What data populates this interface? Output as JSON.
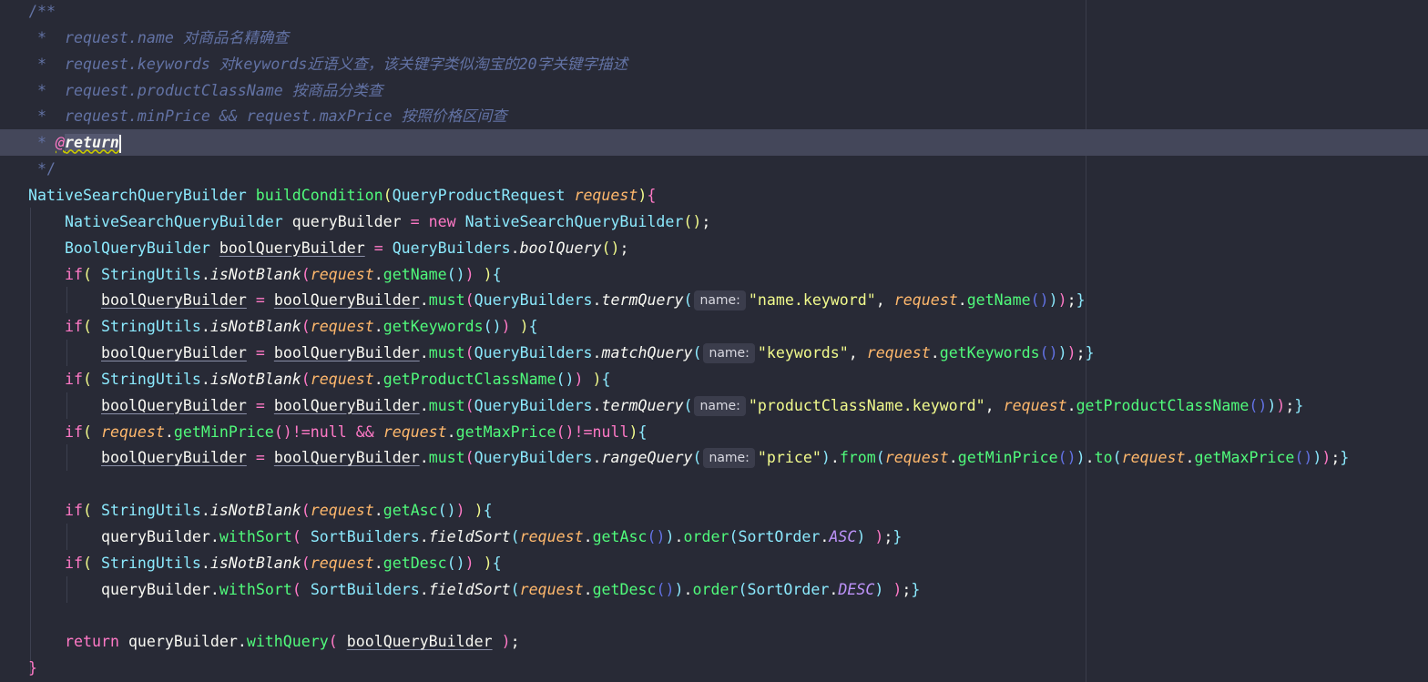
{
  "editor": {
    "lines": [
      {
        "indent": 0,
        "tokens": [
          [
            "/**",
            "cs"
          ]
        ]
      },
      {
        "indent": 0,
        "tokens": [
          [
            " *  ",
            "cs"
          ],
          [
            "request.name 对商品名精确查",
            "c"
          ]
        ]
      },
      {
        "indent": 0,
        "tokens": [
          [
            " *  ",
            "cs"
          ],
          [
            "request.keywords 对keywords近语义查，该关键字类似淘宝的20字关键字描述",
            "c"
          ]
        ]
      },
      {
        "indent": 0,
        "tokens": [
          [
            " *  ",
            "cs"
          ],
          [
            "request.productClassName 按商品分类查",
            "c"
          ]
        ]
      },
      {
        "indent": 0,
        "tokens": [
          [
            " *  ",
            "cs"
          ],
          [
            "request.minPrice && request.maxPrice 按照价格区间查",
            "c"
          ]
        ]
      },
      {
        "indent": 0,
        "current": true,
        "tokens": [
          [
            " * ",
            "cs"
          ],
          [
            "@",
            "tag"
          ],
          [
            "return",
            "tagw"
          ],
          [
            "",
            "caret"
          ]
        ]
      },
      {
        "indent": 0,
        "tokens": [
          [
            " */",
            "cs"
          ]
        ]
      },
      {
        "indent": 0,
        "tokens": [
          [
            "NativeSearchQueryBuilder ",
            "t"
          ],
          [
            "buildCondition",
            "f"
          ],
          [
            "(",
            "b1"
          ],
          [
            "QueryProductRequest ",
            "t"
          ],
          [
            "request",
            "p"
          ],
          [
            ")",
            "b1"
          ],
          [
            "{",
            "b2"
          ]
        ]
      },
      {
        "indent": 1,
        "tokens": [
          [
            "NativeSearchQueryBuilder ",
            "t"
          ],
          [
            "queryBuilder ",
            "v"
          ],
          [
            "= ",
            "k"
          ],
          [
            "new ",
            "k"
          ],
          [
            "NativeSearchQueryBuilder",
            "t"
          ],
          [
            "()",
            "b1"
          ],
          [
            ";",
            "v"
          ]
        ]
      },
      {
        "indent": 1,
        "tokens": [
          [
            "BoolQueryBuilder ",
            "t"
          ],
          [
            "boolQueryBuilder",
            "u"
          ],
          [
            " = ",
            "k"
          ],
          [
            "QueryBuilders",
            "t"
          ],
          [
            ".",
            "v"
          ],
          [
            "boolQuery",
            "m"
          ],
          [
            "()",
            "b1"
          ],
          [
            ";",
            "v"
          ]
        ]
      },
      {
        "indent": 1,
        "tokens": [
          [
            "if",
            "k"
          ],
          [
            "( ",
            "b1"
          ],
          [
            "StringUtils",
            "t"
          ],
          [
            ".",
            "v"
          ],
          [
            "isNotBlank",
            "m"
          ],
          [
            "(",
            "b2"
          ],
          [
            "request",
            "p"
          ],
          [
            ".",
            "v"
          ],
          [
            "getName",
            "f"
          ],
          [
            "()",
            "b3"
          ],
          [
            ")",
            "b2"
          ],
          [
            " )",
            "b1"
          ],
          [
            "{",
            "b3"
          ]
        ]
      },
      {
        "indent": 2,
        "tokens": [
          [
            "boolQueryBuilder",
            "u"
          ],
          [
            " = ",
            "k"
          ],
          [
            "boolQueryBuilder",
            "u"
          ],
          [
            ".",
            "v"
          ],
          [
            "must",
            "f"
          ],
          [
            "(",
            "b2"
          ],
          [
            "QueryBuilders",
            "t"
          ],
          [
            ".",
            "v"
          ],
          [
            "termQuery",
            "m"
          ],
          [
            "(",
            "b3"
          ],
          [
            "name:",
            "h"
          ],
          [
            "\"name.keyword\"",
            "s"
          ],
          [
            ", ",
            "v"
          ],
          [
            "request",
            "p"
          ],
          [
            ".",
            "v"
          ],
          [
            "getName",
            "f"
          ],
          [
            "()",
            "b4"
          ],
          [
            ")",
            "b3"
          ],
          [
            ")",
            "b2"
          ],
          [
            ";",
            "v"
          ],
          [
            "}",
            "b3"
          ]
        ]
      },
      {
        "indent": 1,
        "tokens": [
          [
            "if",
            "k"
          ],
          [
            "( ",
            "b1"
          ],
          [
            "StringUtils",
            "t"
          ],
          [
            ".",
            "v"
          ],
          [
            "isNotBlank",
            "m"
          ],
          [
            "(",
            "b2"
          ],
          [
            "request",
            "p"
          ],
          [
            ".",
            "v"
          ],
          [
            "getKeywords",
            "f"
          ],
          [
            "()",
            "b3"
          ],
          [
            ")",
            "b2"
          ],
          [
            " )",
            "b1"
          ],
          [
            "{",
            "b3"
          ]
        ]
      },
      {
        "indent": 2,
        "tokens": [
          [
            "boolQueryBuilder",
            "u"
          ],
          [
            " = ",
            "k"
          ],
          [
            "boolQueryBuilder",
            "u"
          ],
          [
            ".",
            "v"
          ],
          [
            "must",
            "f"
          ],
          [
            "(",
            "b2"
          ],
          [
            "QueryBuilders",
            "t"
          ],
          [
            ".",
            "v"
          ],
          [
            "matchQuery",
            "m"
          ],
          [
            "(",
            "b3"
          ],
          [
            "name:",
            "h"
          ],
          [
            "\"keywords\"",
            "s"
          ],
          [
            ", ",
            "v"
          ],
          [
            "request",
            "p"
          ],
          [
            ".",
            "v"
          ],
          [
            "getKeywords",
            "f"
          ],
          [
            "()",
            "b4"
          ],
          [
            ")",
            "b3"
          ],
          [
            ")",
            "b2"
          ],
          [
            ";",
            "v"
          ],
          [
            "}",
            "b3"
          ]
        ]
      },
      {
        "indent": 1,
        "tokens": [
          [
            "if",
            "k"
          ],
          [
            "( ",
            "b1"
          ],
          [
            "StringUtils",
            "t"
          ],
          [
            ".",
            "v"
          ],
          [
            "isNotBlank",
            "m"
          ],
          [
            "(",
            "b2"
          ],
          [
            "request",
            "p"
          ],
          [
            ".",
            "v"
          ],
          [
            "getProductClassName",
            "f"
          ],
          [
            "()",
            "b3"
          ],
          [
            ")",
            "b2"
          ],
          [
            " )",
            "b1"
          ],
          [
            "{",
            "b3"
          ]
        ]
      },
      {
        "indent": 2,
        "tokens": [
          [
            "boolQueryBuilder",
            "u"
          ],
          [
            " = ",
            "k"
          ],
          [
            "boolQueryBuilder",
            "u"
          ],
          [
            ".",
            "v"
          ],
          [
            "must",
            "f"
          ],
          [
            "(",
            "b2"
          ],
          [
            "QueryBuilders",
            "t"
          ],
          [
            ".",
            "v"
          ],
          [
            "termQuery",
            "m"
          ],
          [
            "(",
            "b3"
          ],
          [
            "name:",
            "h"
          ],
          [
            "\"productClassName.keyword\"",
            "s"
          ],
          [
            ", ",
            "v"
          ],
          [
            "request",
            "p"
          ],
          [
            ".",
            "v"
          ],
          [
            "getProductClassName",
            "f"
          ],
          [
            "()",
            "b4"
          ],
          [
            ")",
            "b3"
          ],
          [
            ")",
            "b2"
          ],
          [
            ";",
            "v"
          ],
          [
            "}",
            "b3"
          ]
        ]
      },
      {
        "indent": 1,
        "tokens": [
          [
            "if",
            "k"
          ],
          [
            "( ",
            "b1"
          ],
          [
            "request",
            "p"
          ],
          [
            ".",
            "v"
          ],
          [
            "getMinPrice",
            "f"
          ],
          [
            "()",
            "b2"
          ],
          [
            "!=null ",
            "k"
          ],
          [
            "&& ",
            "k"
          ],
          [
            "request",
            "p"
          ],
          [
            ".",
            "v"
          ],
          [
            "getMaxPrice",
            "f"
          ],
          [
            "()",
            "b2"
          ],
          [
            "!=null",
            "k"
          ],
          [
            ")",
            "b1"
          ],
          [
            "{",
            "b3"
          ]
        ]
      },
      {
        "indent": 2,
        "tokens": [
          [
            "boolQueryBuilder",
            "u"
          ],
          [
            " = ",
            "k"
          ],
          [
            "boolQueryBuilder",
            "u"
          ],
          [
            ".",
            "v"
          ],
          [
            "must",
            "f"
          ],
          [
            "(",
            "b2"
          ],
          [
            "QueryBuilders",
            "t"
          ],
          [
            ".",
            "v"
          ],
          [
            "rangeQuery",
            "m"
          ],
          [
            "(",
            "b3"
          ],
          [
            "name:",
            "h"
          ],
          [
            "\"price\"",
            "s"
          ],
          [
            ")",
            "b3"
          ],
          [
            ".",
            "v"
          ],
          [
            "from",
            "f"
          ],
          [
            "(",
            "b3"
          ],
          [
            "request",
            "p"
          ],
          [
            ".",
            "v"
          ],
          [
            "getMinPrice",
            "f"
          ],
          [
            "()",
            "b4"
          ],
          [
            ")",
            "b3"
          ],
          [
            ".",
            "v"
          ],
          [
            "to",
            "f"
          ],
          [
            "(",
            "b3"
          ],
          [
            "request",
            "p"
          ],
          [
            ".",
            "v"
          ],
          [
            "getMaxPrice",
            "f"
          ],
          [
            "()",
            "b4"
          ],
          [
            ")",
            "b3"
          ],
          [
            ")",
            "b2"
          ],
          [
            ";",
            "v"
          ],
          [
            "}",
            "b3"
          ]
        ]
      },
      {
        "indent": 1,
        "tokens": []
      },
      {
        "indent": 1,
        "tokens": [
          [
            "if",
            "k"
          ],
          [
            "( ",
            "b1"
          ],
          [
            "StringUtils",
            "t"
          ],
          [
            ".",
            "v"
          ],
          [
            "isNotBlank",
            "m"
          ],
          [
            "(",
            "b2"
          ],
          [
            "request",
            "p"
          ],
          [
            ".",
            "v"
          ],
          [
            "getAsc",
            "f"
          ],
          [
            "()",
            "b3"
          ],
          [
            ")",
            "b2"
          ],
          [
            " )",
            "b1"
          ],
          [
            "{",
            "b3"
          ]
        ]
      },
      {
        "indent": 2,
        "tokens": [
          [
            "queryBuilder",
            "v"
          ],
          [
            ".",
            "v"
          ],
          [
            "withSort",
            "f"
          ],
          [
            "( ",
            "b2"
          ],
          [
            "SortBuilders",
            "t"
          ],
          [
            ".",
            "v"
          ],
          [
            "fieldSort",
            "m"
          ],
          [
            "(",
            "b3"
          ],
          [
            "request",
            "p"
          ],
          [
            ".",
            "v"
          ],
          [
            "getAsc",
            "f"
          ],
          [
            "()",
            "b4"
          ],
          [
            ")",
            "b3"
          ],
          [
            ".",
            "v"
          ],
          [
            "order",
            "f"
          ],
          [
            "(",
            "b3"
          ],
          [
            "SortOrder",
            "t"
          ],
          [
            ".",
            "v"
          ],
          [
            "ASC",
            "n"
          ],
          [
            ")",
            "b3"
          ],
          [
            " )",
            "b2"
          ],
          [
            ";",
            "v"
          ],
          [
            "}",
            "b3"
          ]
        ]
      },
      {
        "indent": 1,
        "tokens": [
          [
            "if",
            "k"
          ],
          [
            "( ",
            "b1"
          ],
          [
            "StringUtils",
            "t"
          ],
          [
            ".",
            "v"
          ],
          [
            "isNotBlank",
            "m"
          ],
          [
            "(",
            "b2"
          ],
          [
            "request",
            "p"
          ],
          [
            ".",
            "v"
          ],
          [
            "getDesc",
            "f"
          ],
          [
            "()",
            "b3"
          ],
          [
            ")",
            "b2"
          ],
          [
            " )",
            "b1"
          ],
          [
            "{",
            "b3"
          ]
        ]
      },
      {
        "indent": 2,
        "tokens": [
          [
            "queryBuilder",
            "v"
          ],
          [
            ".",
            "v"
          ],
          [
            "withSort",
            "f"
          ],
          [
            "( ",
            "b2"
          ],
          [
            "SortBuilders",
            "t"
          ],
          [
            ".",
            "v"
          ],
          [
            "fieldSort",
            "m"
          ],
          [
            "(",
            "b3"
          ],
          [
            "request",
            "p"
          ],
          [
            ".",
            "v"
          ],
          [
            "getDesc",
            "f"
          ],
          [
            "()",
            "b4"
          ],
          [
            ")",
            "b3"
          ],
          [
            ".",
            "v"
          ],
          [
            "order",
            "f"
          ],
          [
            "(",
            "b3"
          ],
          [
            "SortOrder",
            "t"
          ],
          [
            ".",
            "v"
          ],
          [
            "DESC",
            "n"
          ],
          [
            ")",
            "b3"
          ],
          [
            " )",
            "b2"
          ],
          [
            ";",
            "v"
          ],
          [
            "}",
            "b3"
          ]
        ]
      },
      {
        "indent": 1,
        "tokens": []
      },
      {
        "indent": 1,
        "tokens": [
          [
            "return ",
            "k"
          ],
          [
            "queryBuilder",
            "v"
          ],
          [
            ".",
            "v"
          ],
          [
            "withQuery",
            "f"
          ],
          [
            "( ",
            "b2"
          ],
          [
            "boolQueryBuilder",
            "u"
          ],
          [
            " )",
            "b2"
          ],
          [
            ";",
            "v"
          ]
        ]
      },
      {
        "indent": 0,
        "tokens": [
          [
            "}",
            "b2"
          ]
        ]
      }
    ]
  }
}
